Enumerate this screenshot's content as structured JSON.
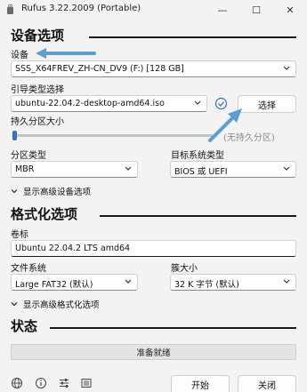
{
  "window": {
    "title": "Rufus 3.22.2009 (Portable)",
    "minimize_glyph": "—",
    "maximize_glyph": "☐",
    "close_glyph": "✕"
  },
  "drive_section": {
    "heading": "设备选项",
    "device_label": "设备",
    "device_value": "SSS_X64FREV_ZH-CN_DV9 (F:) [128 GB]",
    "boot_label": "引导类型选择",
    "boot_value": "ubuntu-22.04.2-desktop-amd64.iso",
    "select_button": "选择",
    "persistent_label": "持久分区大小",
    "persistent_value": "(无持久分区)",
    "persistent_fraction": 0,
    "partition_label": "分区类型",
    "partition_value": "MBR",
    "target_label": "目标系统类型",
    "target_value": "BIOS 或 UEFI",
    "advanced_toggle": "显示高级设备选项"
  },
  "format_section": {
    "heading": "格式化选项",
    "volume_label": "卷标",
    "volume_value": "Ubuntu 22.04.2 LTS amd64",
    "filesystem_label": "文件系统",
    "filesystem_value": "Large FAT32 (默认)",
    "cluster_label": "簇大小",
    "cluster_value": "32 K 字节 (默认)",
    "advanced_toggle": "显示高级格式化选项"
  },
  "status_section": {
    "heading": "状态",
    "status_text": "准备就绪"
  },
  "footer": {
    "start_button": "开始",
    "close_button": "关闭",
    "icons": [
      "globe-icon",
      "info-icon",
      "settings-sliders-icon",
      "log-icon"
    ]
  },
  "colors": {
    "accent": "#3a6fc9",
    "annotation_arrow": "#5a9fd4",
    "window_bg": "#f3f3f3"
  }
}
